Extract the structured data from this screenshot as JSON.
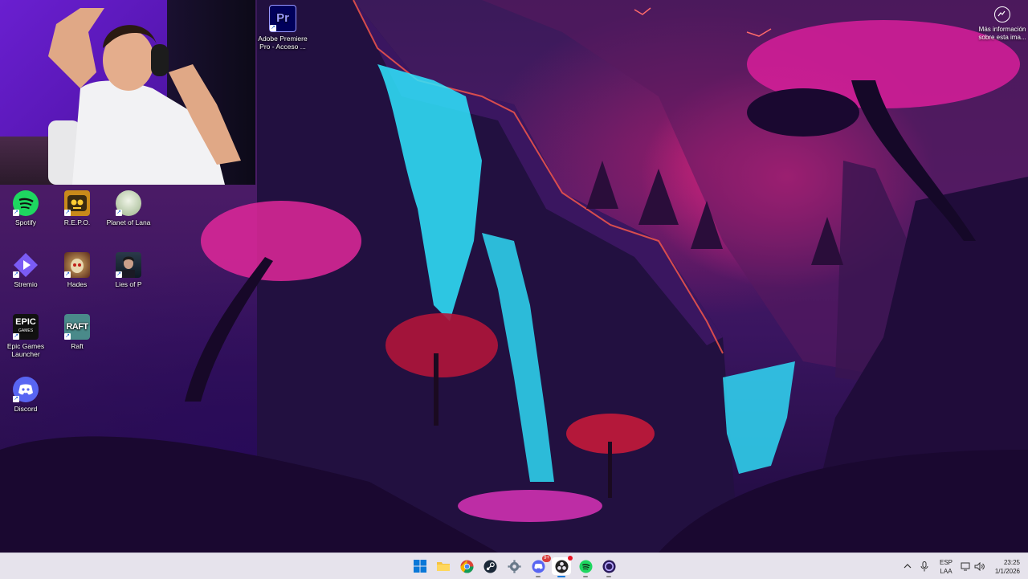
{
  "desktop": {
    "icons": [
      {
        "label": "Adobe Premiere Pro - Acceso ...",
        "icon": "premiere-pro-icon"
      },
      {
        "label": "Spotify",
        "icon": "spotify-icon"
      },
      {
        "label": "R.E.P.O.",
        "icon": "repo-game-icon"
      },
      {
        "label": "Planet of Lana",
        "icon": "planet-of-lana-icon"
      },
      {
        "label": "Stremio",
        "icon": "stremio-icon"
      },
      {
        "label": "Hades",
        "icon": "hades-icon"
      },
      {
        "label": "Lies of P",
        "icon": "lies-of-p-icon"
      },
      {
        "label": "Epic Games Launcher",
        "icon": "epic-games-icon"
      },
      {
        "label": "Raft",
        "icon": "raft-icon"
      },
      {
        "label": "Discord",
        "icon": "discord-icon"
      }
    ],
    "info_button": {
      "label": "Más información sobre esta ima..."
    }
  },
  "taskbar": {
    "apps": [
      "windows-start-icon",
      "file-explorer-icon",
      "chrome-icon",
      "steam-icon",
      "settings-icon",
      "discord-icon",
      "obs-icon",
      "spotify-icon",
      "app-icon"
    ],
    "discord_badge": "9+",
    "tray": {
      "language_line1": "ESP",
      "language_line2": "LAA",
      "time": "23:25",
      "date": "1/1/2026"
    }
  },
  "colors": {
    "taskbar_bg": "#e6e3ec",
    "accent_pink": "#ff2a8c",
    "waterfall_cyan": "#2fe6ff"
  }
}
